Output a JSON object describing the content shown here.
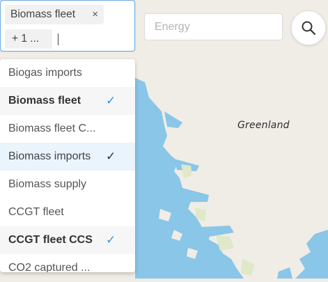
{
  "map": {
    "label": "Greenland",
    "colors": {
      "land": "#f0ece6",
      "water": "#89c6e8",
      "vegetation": "#dfe8c9"
    }
  },
  "multiselect": {
    "selected_chip": "Biomass fleet",
    "remove_symbol": "×",
    "more_chip": "+ 1 ...",
    "border_color": "#6aa9e6",
    "options": [
      {
        "label": "Biogas imports",
        "selected": false
      },
      {
        "label": "Biomass fleet",
        "selected": true
      },
      {
        "label": "Biomass fleet C...",
        "selected": false
      },
      {
        "label": "Biomass imports",
        "selected": true
      },
      {
        "label": "Biomass supply",
        "selected": false
      },
      {
        "label": "CCGT fleet",
        "selected": false
      },
      {
        "label": "CCGT fleet CCS",
        "selected": true
      },
      {
        "label": "CO2 captured ...",
        "selected": false
      }
    ],
    "check_symbol": "✓",
    "check_color": "#3a8ee6"
  },
  "energy_input": {
    "placeholder": "Energy",
    "value": ""
  },
  "search_button": {
    "icon": "search-icon"
  }
}
